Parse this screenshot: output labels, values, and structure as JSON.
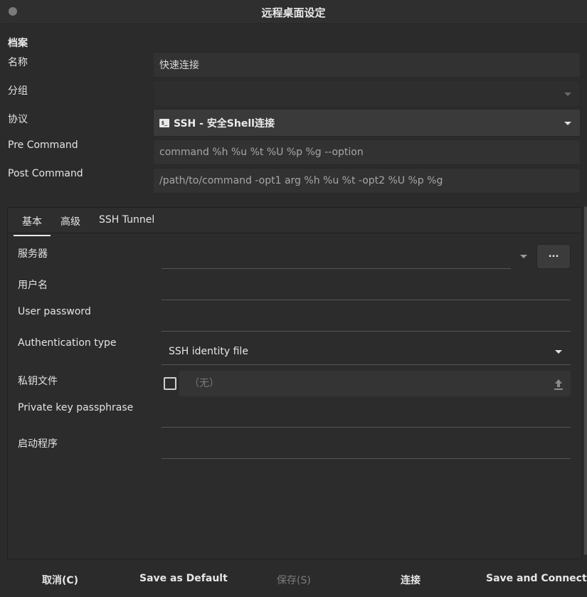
{
  "window": {
    "title": "远程桌面设定"
  },
  "profile": {
    "heading": "档案",
    "name_label": "名称",
    "name_value": "快速连接",
    "group_label": "分组",
    "group_value": "",
    "protocol_label": "协议",
    "protocol_value": "SSH - 安全Shell连接",
    "protocol_icon": "terminal-icon",
    "pre_command_label": "Pre Command",
    "pre_command_placeholder": "command %h %u %t %U %p %g --option",
    "post_command_label": "Post Command",
    "post_command_placeholder": "/path/to/command -opt1 arg %h %u %t -opt2 %U %p %g"
  },
  "tabs": [
    {
      "label": "基本",
      "active": true
    },
    {
      "label": "高级",
      "active": false
    },
    {
      "label": "SSH Tunnel",
      "active": false
    }
  ],
  "basic": {
    "server_label": "服务器",
    "server_value": "",
    "more_button": "...",
    "username_label": "用户名",
    "username_value": "",
    "password_label": "User password",
    "password_value": "",
    "auth_type_label": "Authentication type",
    "auth_type_value": "SSH identity file",
    "private_key_label": "私钥文件",
    "private_key_value": "（无）",
    "passphrase_label": "Private key passphrase",
    "passphrase_value": "",
    "startup_label": "启动程序",
    "startup_value": ""
  },
  "buttons": {
    "cancel": "取消(C)",
    "save_default": "Save as Default",
    "save": "保存(S)",
    "connect": "连接",
    "save_connect": "Save and Connect"
  },
  "colors": {
    "background": "#2b2b2b",
    "field": "#323232",
    "text": "#e6e6e6",
    "disabled": "#7c7c7c"
  }
}
